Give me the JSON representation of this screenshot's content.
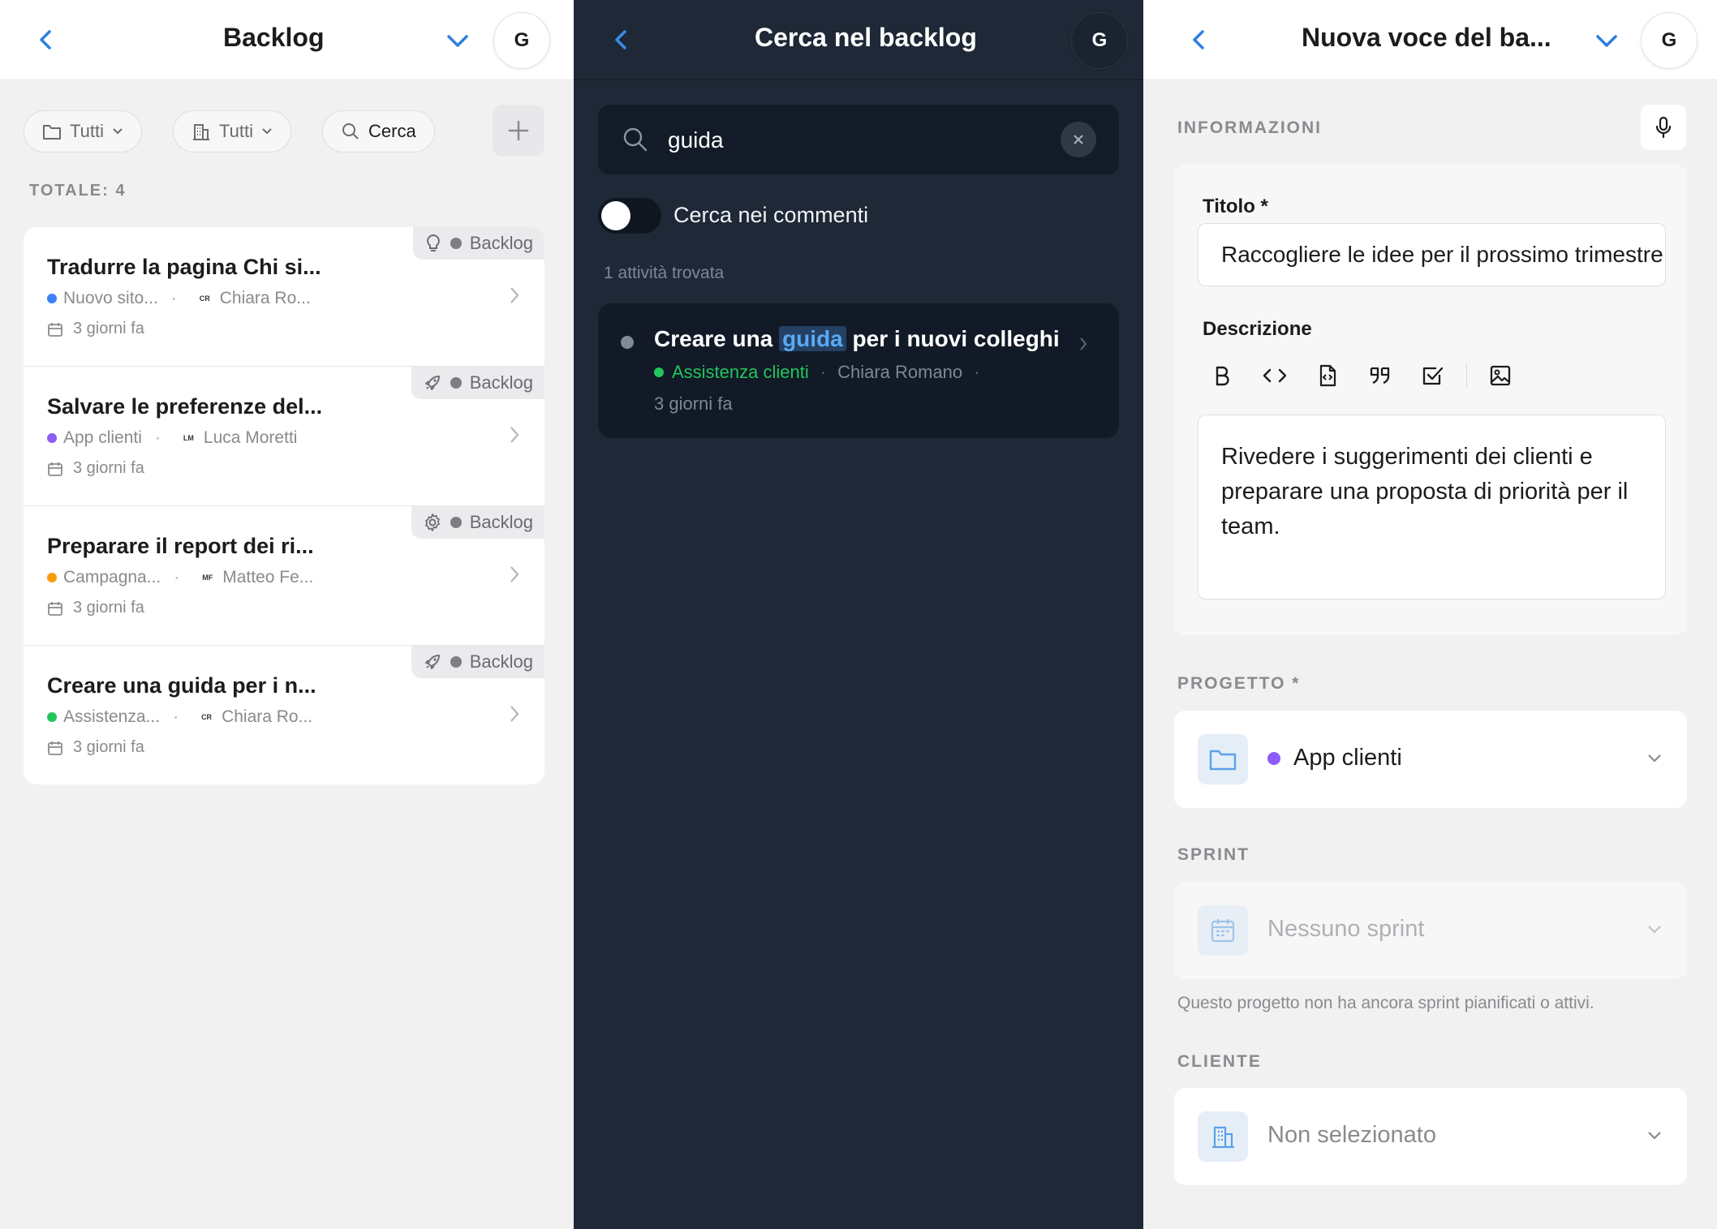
{
  "panel_backlog": {
    "title": "Backlog",
    "avatar": "G",
    "filters": [
      {
        "label": "Tutti",
        "icon": "folder-icon"
      },
      {
        "label": "Tutti",
        "icon": "building-icon"
      },
      {
        "label": "Cerca",
        "icon": "search-icon"
      }
    ],
    "total_label": "TOTALE: 4",
    "items": [
      {
        "title": "Tradurre la pagina Chi si...",
        "status": "Backlog",
        "type_icon": "lightbulb-icon",
        "project": "Nuovo sito...",
        "project_color": "#3b82f6",
        "assignee_initials": "CR",
        "assignee": "Chiara Ro...",
        "date": "3 giorni fa"
      },
      {
        "title": "Salvare le preferenze del...",
        "status": "Backlog",
        "type_icon": "rocket-icon",
        "project": "App clienti",
        "project_color": "#8b5cf6",
        "assignee_initials": "LM",
        "assignee": "Luca Moretti",
        "date": "3 giorni fa"
      },
      {
        "title": "Preparare il report dei ri...",
        "status": "Backlog",
        "type_icon": "gear-icon",
        "project": "Campagna...",
        "project_color": "#f59e0b",
        "assignee_initials": "MF",
        "assignee": "Matteo Fe...",
        "date": "3 giorni fa"
      },
      {
        "title": "Creare una guida per i n...",
        "status": "Backlog",
        "type_icon": "rocket-icon",
        "project": "Assistenza...",
        "project_color": "#22c55e",
        "assignee_initials": "CR",
        "assignee": "Chiara Ro...",
        "date": "3 giorni fa"
      }
    ]
  },
  "panel_search": {
    "title": "Cerca nel backlog",
    "avatar": "G",
    "query": "guida",
    "toggle_label": "Cerca nei commenti",
    "toggle_on": false,
    "result_count": "1 attività trovata",
    "result": {
      "title_before": "Creare una",
      "title_highlight": "guida",
      "title_after": "per i nuovi colleghi",
      "project": "Assistenza clienti",
      "project_color": "#22c55e",
      "assignee": "Chiara Romano",
      "date": "3 giorni fa"
    }
  },
  "panel_new": {
    "title": "Nuova voce del ba...",
    "avatar": "G",
    "section_info": "INFORMAZIONI",
    "title_label": "Titolo *",
    "title_value": "Raccogliere le idee per il prossimo trimestre",
    "description_label": "Descrizione",
    "toolbar_icons": [
      "bold-icon",
      "code-icon",
      "code-file-icon",
      "quote-icon",
      "checkbox-icon",
      "image-icon"
    ],
    "description_value": "Rivedere i suggerimenti dei clienti e preparare una proposta di priorità per il team.",
    "section_project": "PROGETTO *",
    "project_value": "App clienti",
    "project_color": "#8b5cf6",
    "section_sprint": "SPRINT",
    "sprint_value": "Nessuno sprint",
    "sprint_hint": "Questo progetto non ha ancora sprint pianificati o attivi.",
    "section_client": "CLIENTE",
    "client_value": "Non selezionato"
  },
  "colors": {
    "accent": "#2f7fe0",
    "dark_bg": "#1e2836",
    "highlight": "#5aa9f5"
  }
}
